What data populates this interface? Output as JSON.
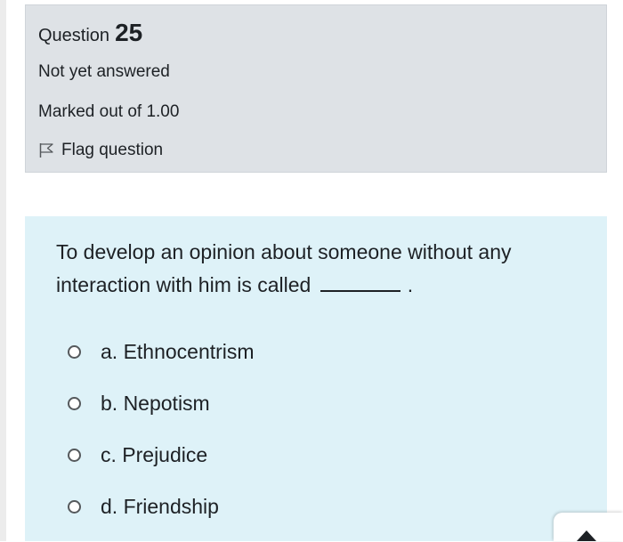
{
  "info": {
    "question_label": "Question",
    "question_number": "25",
    "state": "Not yet answered",
    "grade": "Marked out of 1.00",
    "flag_label": "Flag question"
  },
  "question": {
    "text": "To develop an opinion about someone without any interaction with him is called",
    "trailing": "."
  },
  "answers": [
    {
      "label": "a. Ethnocentrism"
    },
    {
      "label": "b. Nepotism"
    },
    {
      "label": "c. Prejudice"
    },
    {
      "label": "d. Friendship"
    }
  ],
  "colors": {
    "info_background": "#dee2e6",
    "content_background": "#def2f8",
    "text": "#1d2125"
  },
  "icons": {
    "flag": "flag-icon",
    "scroll_top": "arrow-up-icon"
  }
}
